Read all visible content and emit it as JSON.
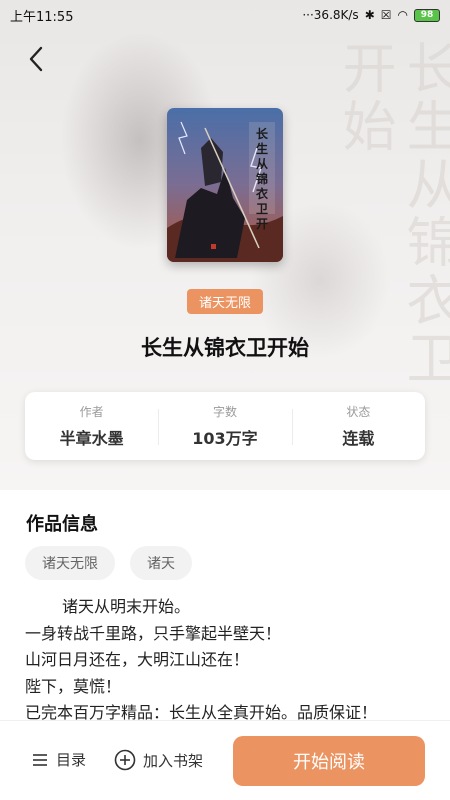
{
  "status_bar": {
    "time": "上午11:55",
    "speed": "36.8K/s",
    "battery": "98"
  },
  "book": {
    "category_tag": "诸天无限",
    "title": "长生从锦衣卫开始",
    "cover_title_text": "长生从锦衣卫开始",
    "stats": [
      {
        "label": "作者",
        "value": "半章水墨"
      },
      {
        "label": "字数",
        "value": "103万字"
      },
      {
        "label": "状态",
        "value": "连载"
      }
    ]
  },
  "info": {
    "section_title": "作品信息",
    "tags": [
      "诸天无限",
      "诸天"
    ],
    "description": [
      "诸天从明末开始。",
      "一身转战千里路，只手擎起半壁天！",
      "山河日月还在，大明江山还在！",
      "陛下，莫慌！",
      "已完本百万字精品：长生从全真开始。品质保证！"
    ]
  },
  "bottom_bar": {
    "toc_label": "目录",
    "shelf_label": "加入书架",
    "read_label": "开始阅读"
  },
  "colors": {
    "accent": "#eb9461"
  }
}
